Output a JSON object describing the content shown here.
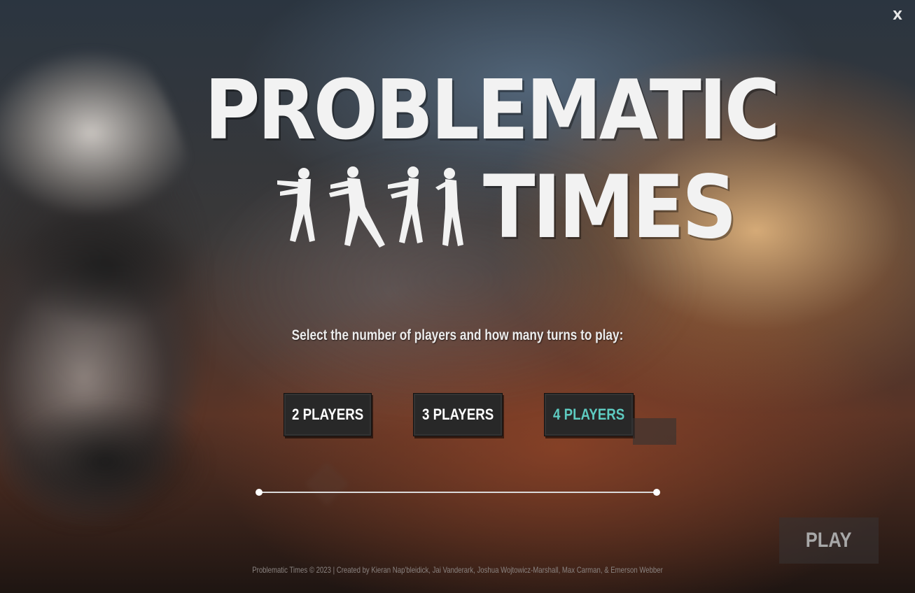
{
  "window": {
    "close_label": "X"
  },
  "title": {
    "line1": "PROBLEMATIC",
    "line2": "TIMES"
  },
  "prompt": "Select the number of players and how many turns to play:",
  "player_options": [
    {
      "label": "2 PLAYERS",
      "selected": false
    },
    {
      "label": "3 PLAYERS",
      "selected": false
    },
    {
      "label": "4 PLAYERS",
      "selected": true
    }
  ],
  "accent_color": "#5ecbc1",
  "play_button": {
    "label": "PLAY",
    "enabled": false
  },
  "credits": "Problematic Times  © 2023  |  Created by Kieran Nap'bleidick, Jai Vanderark, Joshua Wojtowicz-Marshall, Max Carman, & Emerson Webber"
}
